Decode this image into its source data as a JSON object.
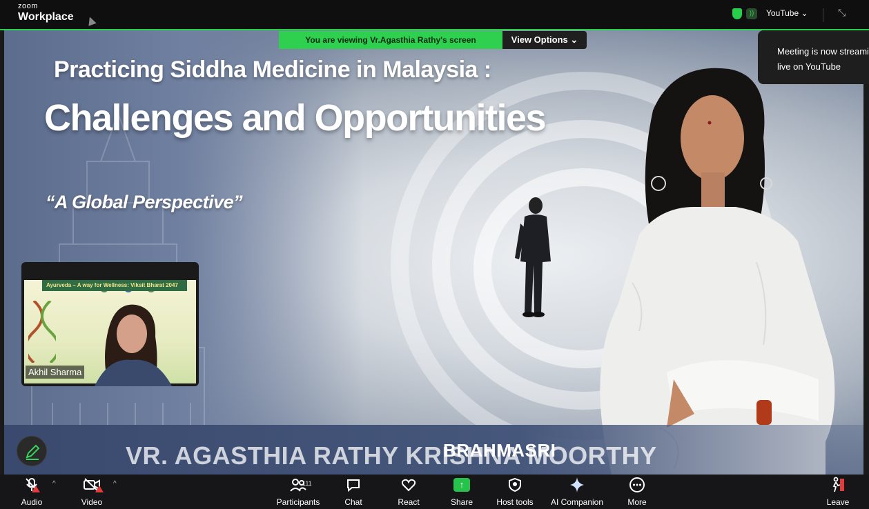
{
  "app": {
    "brand_small": "zoom",
    "brand_large": "Workplace"
  },
  "topbar": {
    "youtube_label": "YouTube",
    "youtube_chevron": "⌄"
  },
  "banner": {
    "viewing_text": "You are viewing  Vr.Agasthia Rathy's screen",
    "view_options_label": "View Options",
    "chevron": "⌄"
  },
  "notification": {
    "line1": "Meeting is now streami",
    "line2": "live on YouTube"
  },
  "slide": {
    "title_line1": "Practicing Siddha Medicine in Malaysia :",
    "title_line2": "Challenges and Opportunities",
    "subtitle": "“A Global Perspective”",
    "honorific": "BRAHMASRI",
    "speaker_name": "VR. AGASTHIA RATHY KRISHNA MOORTHY"
  },
  "thumbnail": {
    "participant_name": "Akhil Sharma",
    "slide_banner": "Ayurveda – A way for Wellness: Viksit Bharat 2047"
  },
  "toolbar": {
    "audio": "Audio",
    "video": "Video",
    "participants": "Participants",
    "participants_count": "111",
    "chat": "Chat",
    "react": "React",
    "share": "Share",
    "host_tools": "Host tools",
    "ai_companion": "AI Companion",
    "more": "More",
    "leave": "Leave"
  },
  "colors": {
    "accent_green": "#27d04a",
    "toolbar_bg": "#161618",
    "alert_red": "#e23b3b"
  },
  "icons": [
    "cursor-icon",
    "shield-icon",
    "stream-icon",
    "minimize-icon",
    "pen-icon",
    "mic-muted-icon",
    "video-off-icon",
    "participants-icon",
    "chat-icon",
    "heart-icon",
    "share-arrow-icon",
    "shield-icon",
    "sparkle-icon",
    "ellipsis-icon",
    "leave-icon"
  ]
}
